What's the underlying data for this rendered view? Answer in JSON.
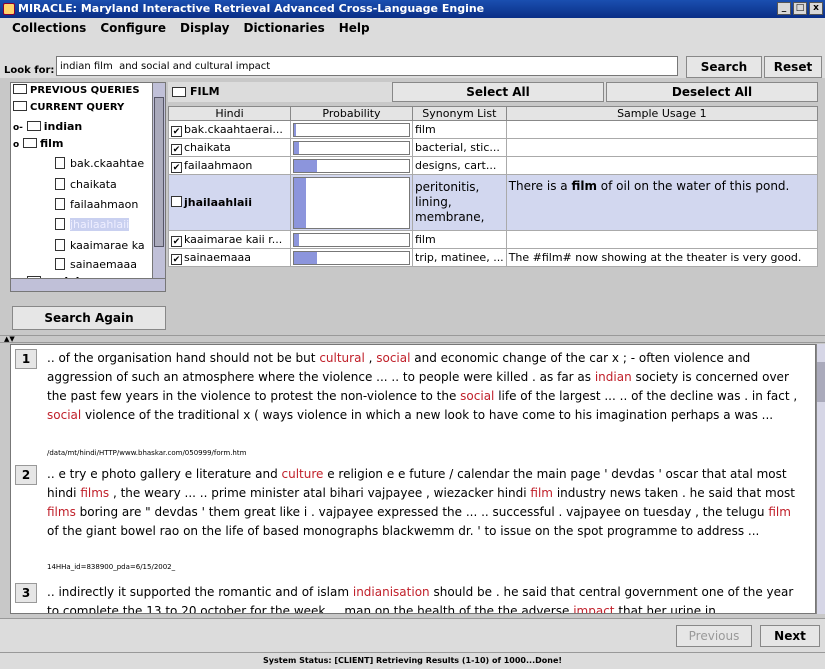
{
  "window": {
    "title": "MIRACLE: Maryland Interactive Retrieval Advanced Cross-Language Engine",
    "min_label": "_",
    "max_label": "□",
    "close_label": "x"
  },
  "menu": [
    "Collections",
    "Configure",
    "Display",
    "Dictionaries",
    "Help"
  ],
  "search": {
    "label": "Look for:",
    "query": "indian film  and social and cultural impact",
    "search_label": "Search",
    "reset_label": "Reset"
  },
  "tree": {
    "previous_label": "PREVIOUS QUERIES",
    "current_label": "CURRENT QUERY",
    "nodes": [
      {
        "label": "indian"
      },
      {
        "label": "film"
      },
      {
        "label": "bak.ckaahtae"
      },
      {
        "label": "chaikata"
      },
      {
        "label": "failaahmaon"
      },
      {
        "label": "jhailaahlaii"
      },
      {
        "label": "kaaimarae ka"
      },
      {
        "label": "sainaemaaa"
      },
      {
        "label": "social"
      }
    ],
    "search_again_label": "Search Again"
  },
  "film_panel": {
    "title": "FILM",
    "select_all_label": "Select All",
    "deselect_all_label": "Deselect All",
    "columns": [
      "Hindi",
      "Probability",
      "Synonym List",
      "Sample Usage 1"
    ],
    "rows": [
      {
        "term": "bak.ckaahtaerai...",
        "checked": true,
        "probability": 0.02,
        "synonyms": "film",
        "usage": ""
      },
      {
        "term": "chaikata",
        "checked": true,
        "probability": 0.04,
        "synonyms": "bacterial, stic...",
        "usage": ""
      },
      {
        "term": "failaahmaon",
        "checked": true,
        "probability": 0.2,
        "synonyms": "designs, cart...",
        "usage": ""
      },
      {
        "term": "jhailaahlaii",
        "checked": false,
        "probability": 0.1,
        "synonyms": "peritonitis, lining, membrane,",
        "usage_pre": "There is a ",
        "usage_bold": "film",
        "usage_post": " of oil on the water of this pond."
      },
      {
        "term": "kaaimarae kaii r...",
        "checked": true,
        "probability": 0.04,
        "synonyms": "film",
        "usage": ""
      },
      {
        "term": "sainaemaaa",
        "checked": true,
        "probability": 0.2,
        "synonyms": "trip, matinee, ...",
        "usage": "The #film# now showing at the theater is very good."
      }
    ]
  },
  "results": [
    {
      "num": "1",
      "source": "/data/mt/hindi/HTTP/www.bhaskar.com/050999/form.htm",
      "segments": [
        {
          "t": ".. of the organisation hand should not be but "
        },
        {
          "t": "cultural",
          "h": true
        },
        {
          "t": " , "
        },
        {
          "t": "social",
          "h": true
        },
        {
          "t": " and economic change of the car x ; - often violence and aggression of such an atmosphere where the violence ... .. to people were killed . as far as "
        },
        {
          "t": "indian",
          "h": true
        },
        {
          "t": " society is concerned over the past few years in the violence to protest the non-violence to the "
        },
        {
          "t": "social",
          "h": true
        },
        {
          "t": " life of the largest ... .. of the decline was . in fact , "
        },
        {
          "t": "social",
          "h": true
        },
        {
          "t": " violence of the traditional x ( ways violence in which a new look to have come to his imagination perhaps a was ..."
        }
      ]
    },
    {
      "num": "2",
      "source": "14HHa_id=838900_pda=6/15/2002_",
      "segments": [
        {
          "t": ".. e try e photo gallery e literature and "
        },
        {
          "t": "culture",
          "h": true
        },
        {
          "t": " e religion e e future / calendar the main page ' devdas ' oscar that atal most hindi "
        },
        {
          "t": "films",
          "h": true
        },
        {
          "t": " , the weary ... .. prime minister atal bihari vajpayee , wiezacker hindi "
        },
        {
          "t": "film",
          "h": true
        },
        {
          "t": " industry news taken . he said that most "
        },
        {
          "t": "films",
          "h": true
        },
        {
          "t": " boring are \" devdas ' them great like i . vajpayee expressed the ... .. successful . vajpayee on tuesday , the telugu "
        },
        {
          "t": "film",
          "h": true
        },
        {
          "t": " of the giant bowel rao on the life of based monographs blackwemm dr. ' to issue on the spot programme to address ..."
        }
      ]
    },
    {
      "num": "3",
      "source": "",
      "segments": [
        {
          "t": ".. indirectly it supported the romantic and of islam "
        },
        {
          "t": "indianisation",
          "h": true
        },
        {
          "t": " should be . he said that central government one of the year to complete the 13 to 20 october for the week ... man on the health of the the adverse "
        },
        {
          "t": "impact",
          "h": true
        },
        {
          "t": " that her urine in"
        }
      ]
    }
  ],
  "nav": {
    "previous_label": "Previous",
    "next_label": "Next"
  },
  "status": "System Status: [CLIENT] Retrieving Results (1-10) of 1000...Done!",
  "colors": {
    "title_bar": "#0a2e86",
    "highlight": "#c0202a",
    "probability_fill": "#8c95dc",
    "selected_row": "#d2d7ef"
  }
}
